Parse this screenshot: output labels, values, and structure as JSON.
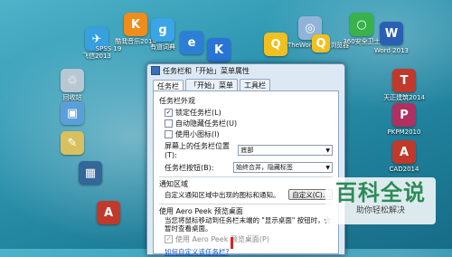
{
  "desktop": {
    "icons": [
      {
        "label": "飞信2013",
        "icon": "fetion-icon",
        "color": "#37a0e0",
        "glyph": "✈"
      },
      {
        "label": "SPSS 19",
        "icon": "spss-icon",
        "color": "#c43b3b",
        "glyph": "S"
      },
      {
        "label": "酷我音乐2014",
        "icon": "kuwo-icon",
        "color": "#f08c1a",
        "glyph": "K"
      },
      {
        "label": "有道词典",
        "icon": "youdao-icon",
        "color": "#3aa4e6",
        "glyph": "g"
      },
      {
        "label": "",
        "icon": "ie-icon",
        "color": "#2d7fd6",
        "glyph": "e"
      },
      {
        "label": "",
        "icon": "kugou-icon",
        "color": "#2a74d8",
        "glyph": "K"
      },
      {
        "label": "",
        "icon": "qq-icon",
        "color": "#f0c020",
        "glyph": "Q"
      },
      {
        "label": "TheWorld安全浏览器",
        "icon": "theworld-icon",
        "color": "#8fb4d8",
        "glyph": "◎"
      },
      {
        "label": "",
        "icon": "qq2-icon",
        "color": "#f0c020",
        "glyph": "Q"
      },
      {
        "label": "360安全卫士",
        "icon": "360-icon",
        "color": "#38b24a",
        "glyph": "○"
      },
      {
        "label": "Word 2013",
        "icon": "word-icon",
        "color": "#2b5fb4",
        "glyph": "W"
      },
      {
        "label": "回收站",
        "icon": "recycle-bin-icon",
        "color": "#b9c7d4",
        "glyph": "♲"
      },
      {
        "label": "",
        "icon": "network-icon",
        "color": "#5aa0d8",
        "glyph": "▣"
      },
      {
        "label": "",
        "icon": "computer-icon",
        "color": "#6aa6dc",
        "glyph": "▭"
      },
      {
        "label": "",
        "icon": "paint-icon",
        "color": "#d8c060",
        "glyph": "✎"
      },
      {
        "label": "",
        "icon": "app-icon",
        "color": "#336699",
        "glyph": "▦"
      },
      {
        "label": "",
        "icon": "cad-icon",
        "color": "#c0392b",
        "glyph": "A"
      },
      {
        "label": "天正建筑2014",
        "icon": "tangent-icon",
        "color": "#c0392b",
        "glyph": "T"
      },
      {
        "label": "PKPM2010",
        "icon": "pkpm-icon",
        "color": "#b03060",
        "glyph": "P"
      },
      {
        "label": "CAD2014",
        "icon": "cad2014-icon",
        "color": "#c0392b",
        "glyph": "A"
      },
      {
        "label": "",
        "icon": "game-icon",
        "color": "#5b8a3a",
        "glyph": "▲"
      }
    ]
  },
  "dialog": {
    "title": "任务栏和「开始」菜单属性",
    "tabs": [
      "任务栏",
      "「开始」菜单",
      "工具栏"
    ],
    "appearance": {
      "title": "任务栏外观",
      "lock": "锁定任务栏(L)",
      "autohide": "自动隐藏任务栏(U)",
      "small_icons": "使用小图标(I)",
      "location_label": "屏幕上的任务栏位置(T):",
      "location_value": "底部",
      "buttons_label": "任务栏按钮(B):",
      "buttons_value": "始终合并，隐藏标签"
    },
    "notify": {
      "title": "通知区域",
      "text": "自定义通知区域中出现的图标和通知。",
      "button": "自定义(C)..."
    },
    "peek": {
      "title": "使用 Aero Peek 预览桌面",
      "text": "当您将鼠标移动到任务栏末端的 \"显示桌面\" 按钮时，会暂时查看桌面。",
      "checkbox": "使用 Aero Peek 预览桌面(P)"
    },
    "link": "如何自定义该任务栏?"
  },
  "watermark": {
    "title": "百科全说",
    "subtitle": "助你轻松解决"
  }
}
